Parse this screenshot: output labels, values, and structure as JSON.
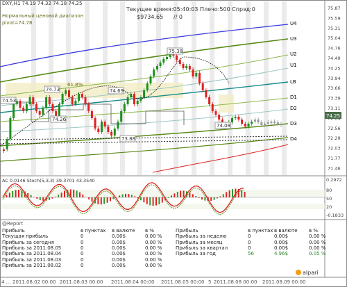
{
  "header": {
    "symbol_ohlc": "DXY,H1 74.19 74.32 74.18 74.25",
    "indicator_name_1": "Нормальный ценовой диапазон",
    "indicator_name_2": "pivot=74.78",
    "time_label": "Текущее время:05:40:03 Плечо:500 Спрэд:0",
    "balance": "$9734.65",
    "slashes": "// 0"
  },
  "price_scale": [
    "75.87",
    "75.59",
    "75.31",
    "75.04",
    "74.76",
    "74.49",
    "74.25",
    "73.94",
    "73.66",
    "73.39",
    "73.11",
    "72.84",
    "72.56",
    "72.29",
    "72.03",
    "71.77",
    "71.46"
  ],
  "levels": [
    "U4",
    "U3",
    "U2",
    "U1",
    "LB",
    "D1",
    "D2",
    "D3",
    "D4"
  ],
  "markers": {
    "m1": "74.53",
    "m2": "74.73",
    "m3": "74.26",
    "m4": "74.69",
    "m5": "73.88",
    "m6": "75.38",
    "m7": "74.08",
    "fib": "61.8%",
    "current": "74.25"
  },
  "oscillator": {
    "title": "AC 0.0146 Stoch(5,3,3) 39.3701 43.3540",
    "scale": [
      "0.2972",
      "80",
      "50",
      "20",
      "-0.1833"
    ]
  },
  "report": {
    "title": "@Report",
    "headers": [
      "Прибыль",
      "в пунктах",
      "в валюте",
      "в %"
    ],
    "left_rows": [
      [
        "Прибыль",
        "0",
        "0.00$",
        "0.00 %"
      ],
      [
        "Текущая прибыль",
        "0",
        "0.00$",
        "0.00 %"
      ],
      [
        "Прибыль за сегодня",
        "0",
        "0.00$",
        "0.00 %"
      ],
      [
        "Прибыль за 2011.08.05",
        "0",
        "0.00$",
        "0.00 %"
      ],
      [
        "Прибыль за 2011.08.04",
        "0",
        "0.00$",
        "0.00 %"
      ],
      [
        "Прибыль за 2011.08.03",
        "0",
        "0.00$",
        "0.00 %"
      ],
      [
        "Прибыль за 2011.08.02",
        "0",
        "0.00$",
        "0.00 %"
      ]
    ],
    "right_rows": [
      [
        "Прибыль",
        "в пунктах",
        "в валюте",
        "в %"
      ],
      [
        "Прибыль за неделю",
        "0",
        "0.00$",
        "0.00 %"
      ],
      [
        "Прибыль за месяц",
        "0",
        "0.00$",
        "0.00 %"
      ],
      [
        "Прибыль за квартал",
        "0",
        "0.00$",
        "0.00 %"
      ],
      [
        "Прибыль за год",
        "56",
        "4.96$",
        "0.05 %"
      ]
    ]
  },
  "logo": "alpari",
  "time_axis": [
    "4 ...",
    "2011.08.02 00:00",
    "2011.08.03 00:00",
    "2011.08.04 00:00",
    "2011.08.05 00:00",
    "5",
    "2011.08.08 00:00",
    "2011.08.09 00:00"
  ]
}
